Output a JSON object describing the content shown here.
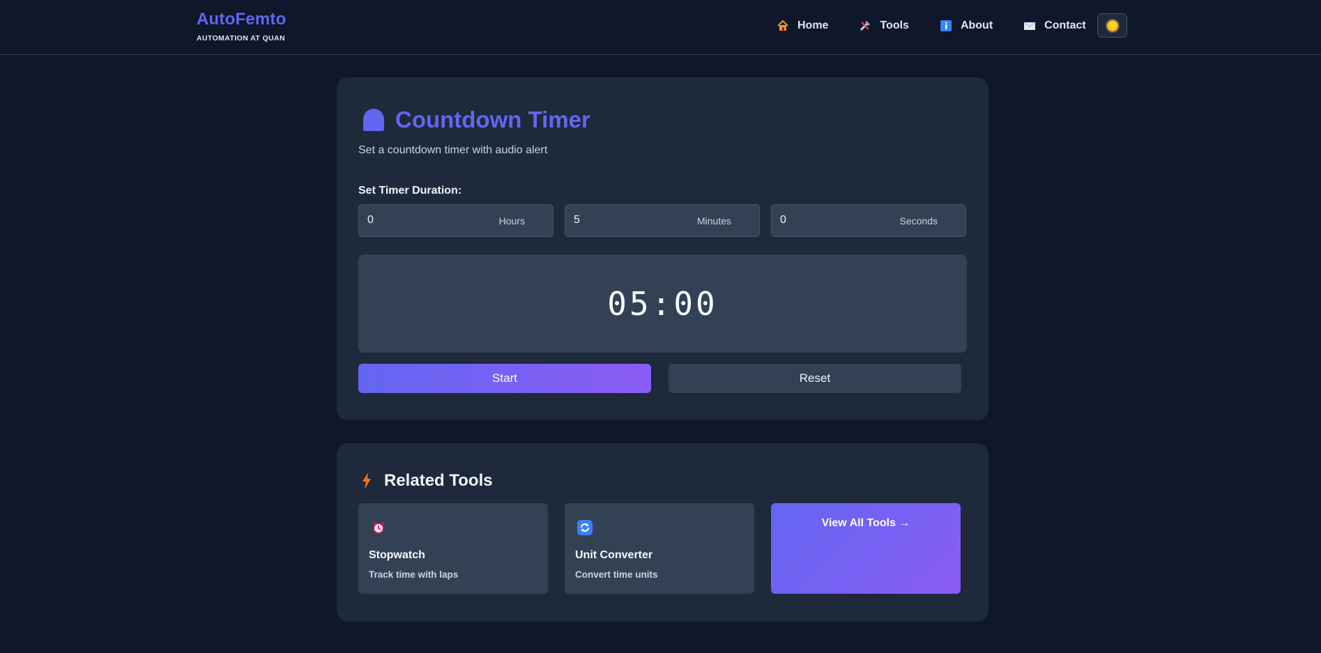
{
  "header": {
    "brand_name": "AutoFemto",
    "brand_tagline": "AUTOMATION AT QUAN",
    "nav": [
      {
        "label": "Home",
        "icon": "home-icon"
      },
      {
        "label": "Tools",
        "icon": "tools-icon"
      },
      {
        "label": "About",
        "icon": "info-icon"
      },
      {
        "label": "Contact",
        "icon": "envelope-icon"
      }
    ],
    "theme_toggle_icon": "sun-icon"
  },
  "timer": {
    "title": "Countdown Timer",
    "title_icon": "timer-icon",
    "subtitle": "Set a countdown timer with audio alert",
    "duration_label": "Set Timer Duration:",
    "fields": [
      {
        "value": "0",
        "unit": "Hours"
      },
      {
        "value": "5",
        "unit": "Minutes"
      },
      {
        "value": "0",
        "unit": "Seconds"
      }
    ],
    "display": "05:00",
    "start_label": "Start",
    "reset_label": "Reset"
  },
  "related": {
    "title": "Related Tools",
    "title_icon": "lightning-icon",
    "tools": [
      {
        "name": "Stopwatch",
        "desc": "Track time with laps",
        "icon": "alarm-clock-icon"
      },
      {
        "name": "Unit Converter",
        "desc": "Convert time units",
        "icon": "refresh-icon"
      }
    ],
    "view_all_label": "View All Tools →"
  },
  "colors": {
    "background": "#0f172a",
    "card": "#1e293b",
    "surface": "#334155",
    "accent": "#6366f1",
    "accent_end": "#8b5cf6"
  }
}
